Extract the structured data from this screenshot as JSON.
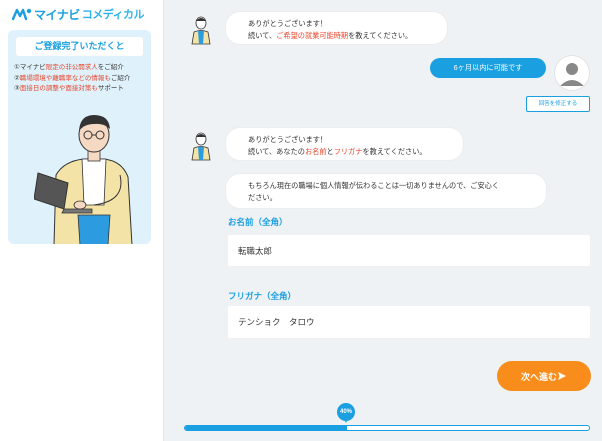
{
  "brand": {
    "name": "マイナビ",
    "product": "コメディカル"
  },
  "card": {
    "title": "ご登録完了いただくと",
    "benefits": [
      {
        "prefix": "①マイナビ",
        "highlight": "限定の非公開求人",
        "suffix": "をご紹介"
      },
      {
        "prefix": "②",
        "highlight": "職場環境や離職率などの情報も",
        "suffix": "ご紹介"
      },
      {
        "prefix": "③",
        "highlight": "面接日の調整や面接対策も",
        "suffix": "サポート"
      }
    ]
  },
  "chat": {
    "msg1": {
      "line1": "ありがとうございます！",
      "line2_prefix": "続いて、",
      "line2_highlight": "ご希望の就業可能時期",
      "line2_suffix": "を教えてください。"
    },
    "user_reply": "6ヶ月以内に可能です",
    "fix_button": "回答を修正する",
    "msg2": {
      "line1": "ありがとうございます！",
      "line2_prefix": "続いて、あなたの",
      "hl1": "お名前",
      "mid": "と",
      "hl2": "フリガナ",
      "line2_suffix": "を教えてください。"
    },
    "msg3": {
      "line1": "もちろん現在の職場に個人情報が伝わることは一切ありませんので、ご安心く",
      "line2": "ださい。"
    }
  },
  "form": {
    "name_label": "お名前（全角）",
    "name_value": "転職太郎",
    "kana_label": "フリガナ（全角）",
    "kana_value": "テンショク　タロウ"
  },
  "next_button": "次へ進む",
  "progress": {
    "percent": 40,
    "label": "40%"
  },
  "colors": {
    "accent": "#1a9fe0",
    "orange": "#f98d1b",
    "highlight": "#e8472d"
  }
}
